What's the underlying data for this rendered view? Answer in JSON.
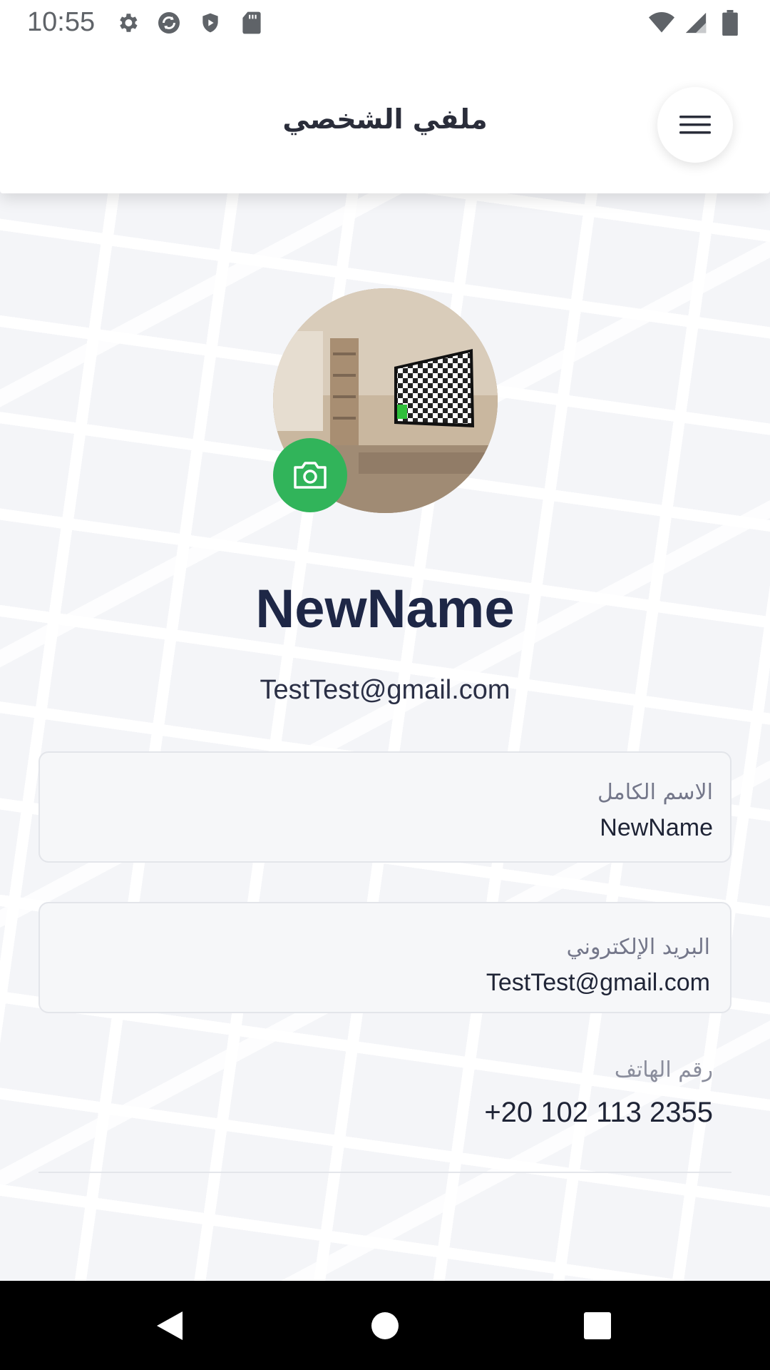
{
  "status_bar": {
    "time": "10:55",
    "left_icons": [
      "settings-icon",
      "sync-icon",
      "shield-play-icon",
      "sd-card-icon"
    ],
    "right_icons": [
      "wifi-icon",
      "signal-icon",
      "battery-icon"
    ]
  },
  "header": {
    "title": "ملفي الشخصي",
    "menu_icon": "hamburger-menu-icon"
  },
  "profile": {
    "avatar_icon": "profile-photo",
    "camera_icon": "camera-icon",
    "name": "NewName",
    "email": "TestTest@gmail.com"
  },
  "fields": {
    "full_name": {
      "label": "الاسم الكامل",
      "value": "NewName"
    },
    "email": {
      "label": "البريد الإلكتروني",
      "value": "TestTest@gmail.com"
    },
    "phone": {
      "label": "رقم الهاتف",
      "value": "+20 102 113 2355"
    }
  },
  "colors": {
    "accent_green": "#31b45a",
    "name_navy": "#1e2746"
  },
  "nav_bar": {
    "icons": [
      "back-icon",
      "home-icon",
      "recents-icon"
    ]
  }
}
